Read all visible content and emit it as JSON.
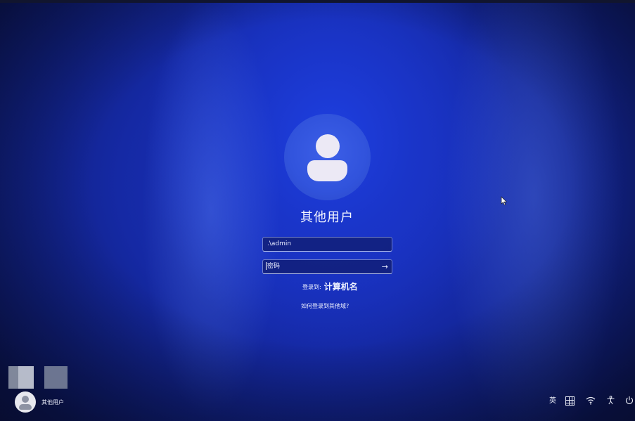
{
  "login": {
    "user_title": "其他用户",
    "username_value": ".\\admin",
    "password_placeholder": "密码",
    "signin_to_label": "登录到:",
    "computer_name": "计算机名",
    "other_domain_link": "如何登录到其他域?"
  },
  "user_switcher": {
    "label": "其他用户"
  },
  "tray": {
    "ime_label": "英",
    "icons": [
      "ime-mode-icon",
      "wifi-icon",
      "accessibility-icon",
      "power-icon"
    ]
  },
  "colors": {
    "background_blue": "#1b34c8",
    "avatar_circle": "#3153dc",
    "text": "#ffffff"
  }
}
